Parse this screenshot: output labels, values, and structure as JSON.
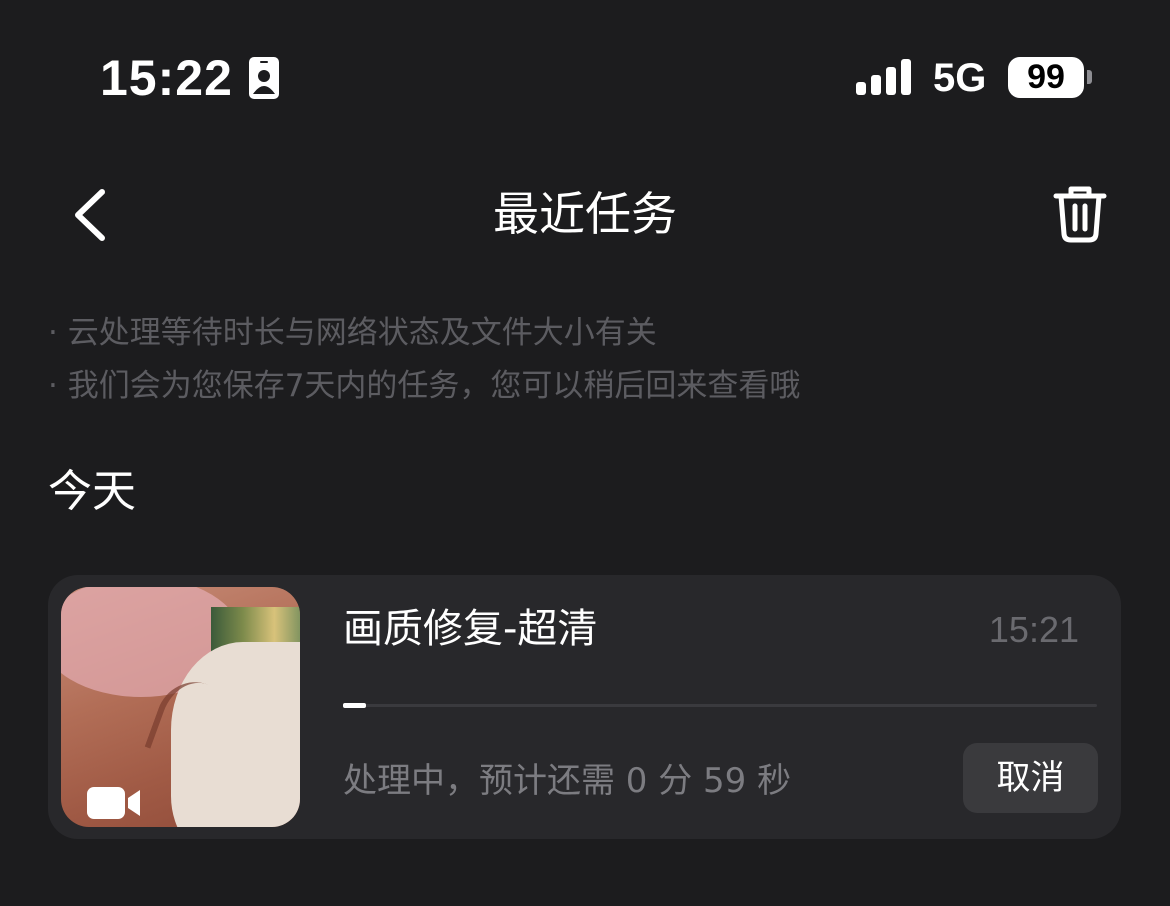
{
  "status_bar": {
    "time": "15:22",
    "network": "5G",
    "battery": "99"
  },
  "nav": {
    "title": "最近任务"
  },
  "notes": [
    "· 云处理等待时长与网络状态及文件大小有关",
    "· 我们会为您保存7天内的任务，您可以稍后回来查看哦"
  ],
  "section": {
    "label": "今天"
  },
  "task": {
    "title": "画质修复-超清",
    "time": "15:21",
    "status": "处理中，预计还需 0 分 59 秒",
    "progress": 0.03,
    "cancel_label": "取消",
    "media_type_icon": "video-camera-icon"
  },
  "colors": {
    "background": "#1c1c1e",
    "card": "#28282b",
    "muted_text": "#5c5c61",
    "secondary_text": "#7c7c81",
    "button_bg": "#3a3a3d"
  }
}
